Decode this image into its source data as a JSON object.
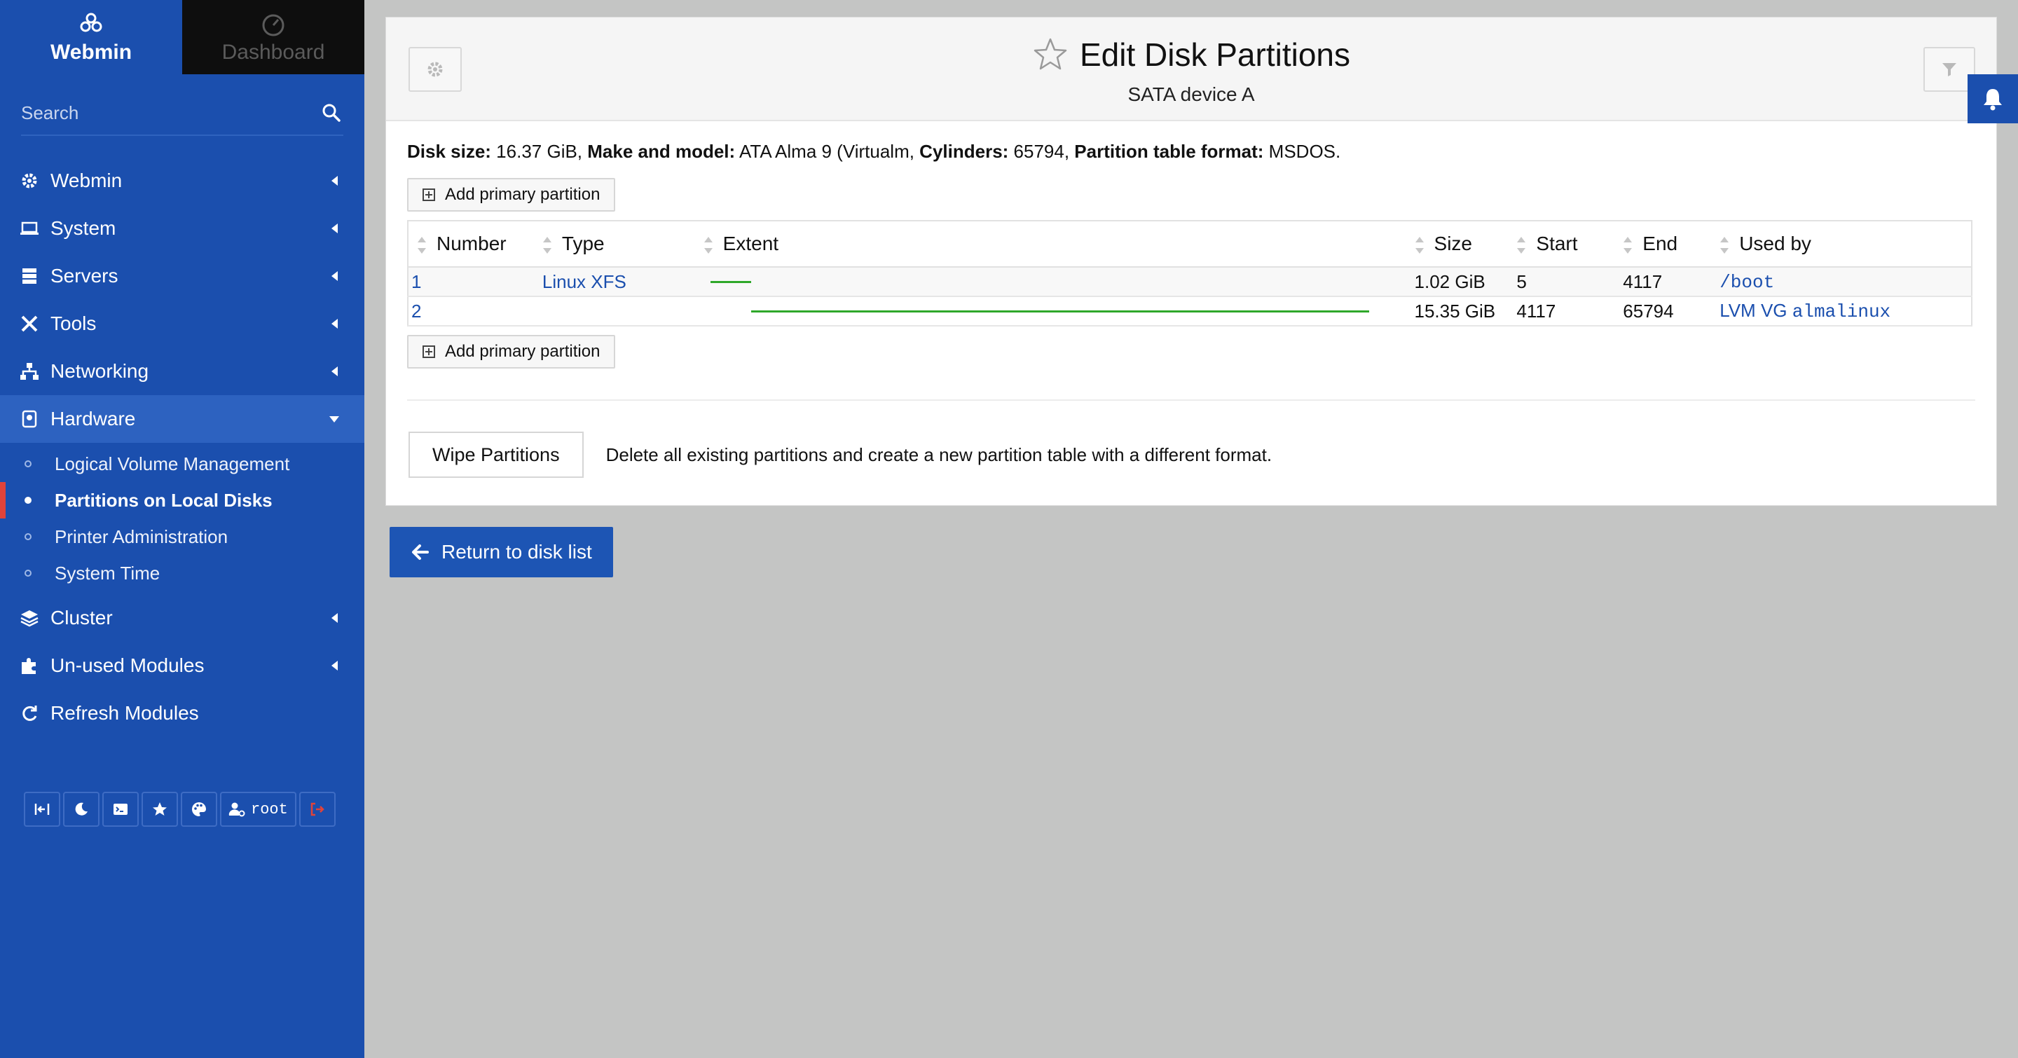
{
  "sidebar": {
    "brand_tabs": [
      {
        "label": "Webmin",
        "icon": "webmin-logo-icon"
      },
      {
        "label": "Dashboard",
        "icon": "dashboard-gauge-icon"
      }
    ],
    "search_placeholder": "Search",
    "nav": [
      {
        "label": "Webmin",
        "icon": "gear-icon"
      },
      {
        "label": "System",
        "icon": "laptop-icon"
      },
      {
        "label": "Servers",
        "icon": "server-stack-icon"
      },
      {
        "label": "Tools",
        "icon": "tools-icon"
      },
      {
        "label": "Networking",
        "icon": "network-icon"
      },
      {
        "label": "Hardware",
        "icon": "hard-disk-icon"
      },
      {
        "label": "Cluster",
        "icon": "layers-icon"
      },
      {
        "label": "Un-used Modules",
        "icon": "puzzle-icon"
      },
      {
        "label": "Refresh Modules",
        "icon": "refresh-icon"
      }
    ],
    "hardware_subitems": [
      {
        "label": "Logical Volume Management"
      },
      {
        "label": "Partitions on Local Disks"
      },
      {
        "label": "Printer Administration"
      },
      {
        "label": "System Time"
      }
    ],
    "toolbar": {
      "user_label": "root"
    }
  },
  "header": {
    "title": "Edit Disk Partitions",
    "subtitle": "SATA device A"
  },
  "disk_info": {
    "size_label": "Disk size:",
    "size_value": " 16.37 GiB,",
    "model_label": " Make and model:",
    "model_value": " ATA Alma 9 (Virtualm,",
    "cylinders_label": " Cylinders:",
    "cylinders_value": " 65794,",
    "format_label": " Partition table format:",
    "format_value": " MSDOS."
  },
  "add_partition_label": "Add primary partition",
  "table": {
    "headers": [
      "Number",
      "Type",
      "Extent",
      "Size",
      "Start",
      "End",
      "Used by"
    ],
    "rows": [
      {
        "number": "1",
        "type": "Linux XFS",
        "size": "1.02 GiB",
        "start": "5",
        "end": "4117",
        "used_prefix": "",
        "used_by": "/boot",
        "extent_start": 5,
        "extent_end": 4117
      },
      {
        "number": "2",
        "type": "",
        "size": "15.35 GiB",
        "start": "4117",
        "end": "65794",
        "used_prefix": "LVM VG ",
        "used_by": "almalinux",
        "extent_start": 4117,
        "extent_end": 65794
      }
    ],
    "total_cylinders": 65794,
    "extent_color": "#2fa82a"
  },
  "wipe": {
    "button_label": "Wipe Partitions",
    "description": "Delete all existing partitions and create a new partition table with a different format."
  },
  "return_label": "Return to disk list",
  "colors": {
    "sidebar": "#1b4fae",
    "accent": "#1d55b4",
    "active_marker": "#e0433a"
  }
}
